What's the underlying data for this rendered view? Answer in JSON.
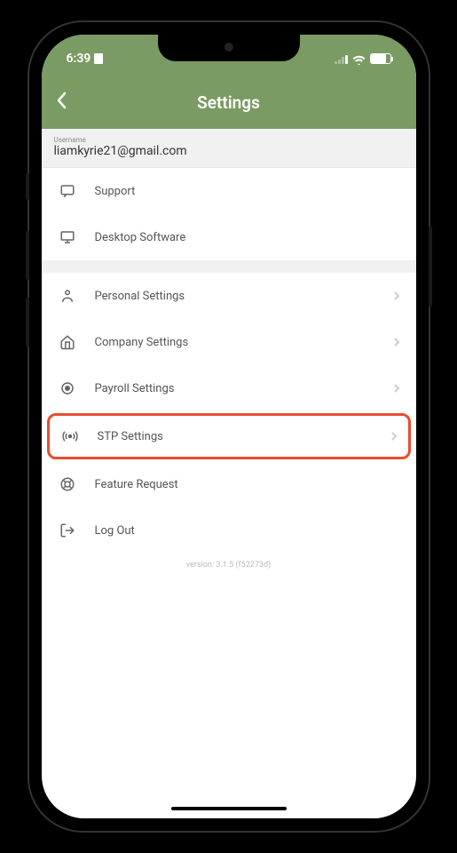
{
  "status": {
    "time": "6:39"
  },
  "header": {
    "title": "Settings"
  },
  "user": {
    "label": "Username",
    "value": "liamkyrie21@gmail.com"
  },
  "items": {
    "support": "Support",
    "desktop": "Desktop Software",
    "personal": "Personal Settings",
    "company": "Company Settings",
    "payroll": "Payroll Settings",
    "stp": "STP Settings",
    "feature": "Feature Request",
    "logout": "Log Out"
  },
  "version": "version: 3.1.5 (f52273d)"
}
